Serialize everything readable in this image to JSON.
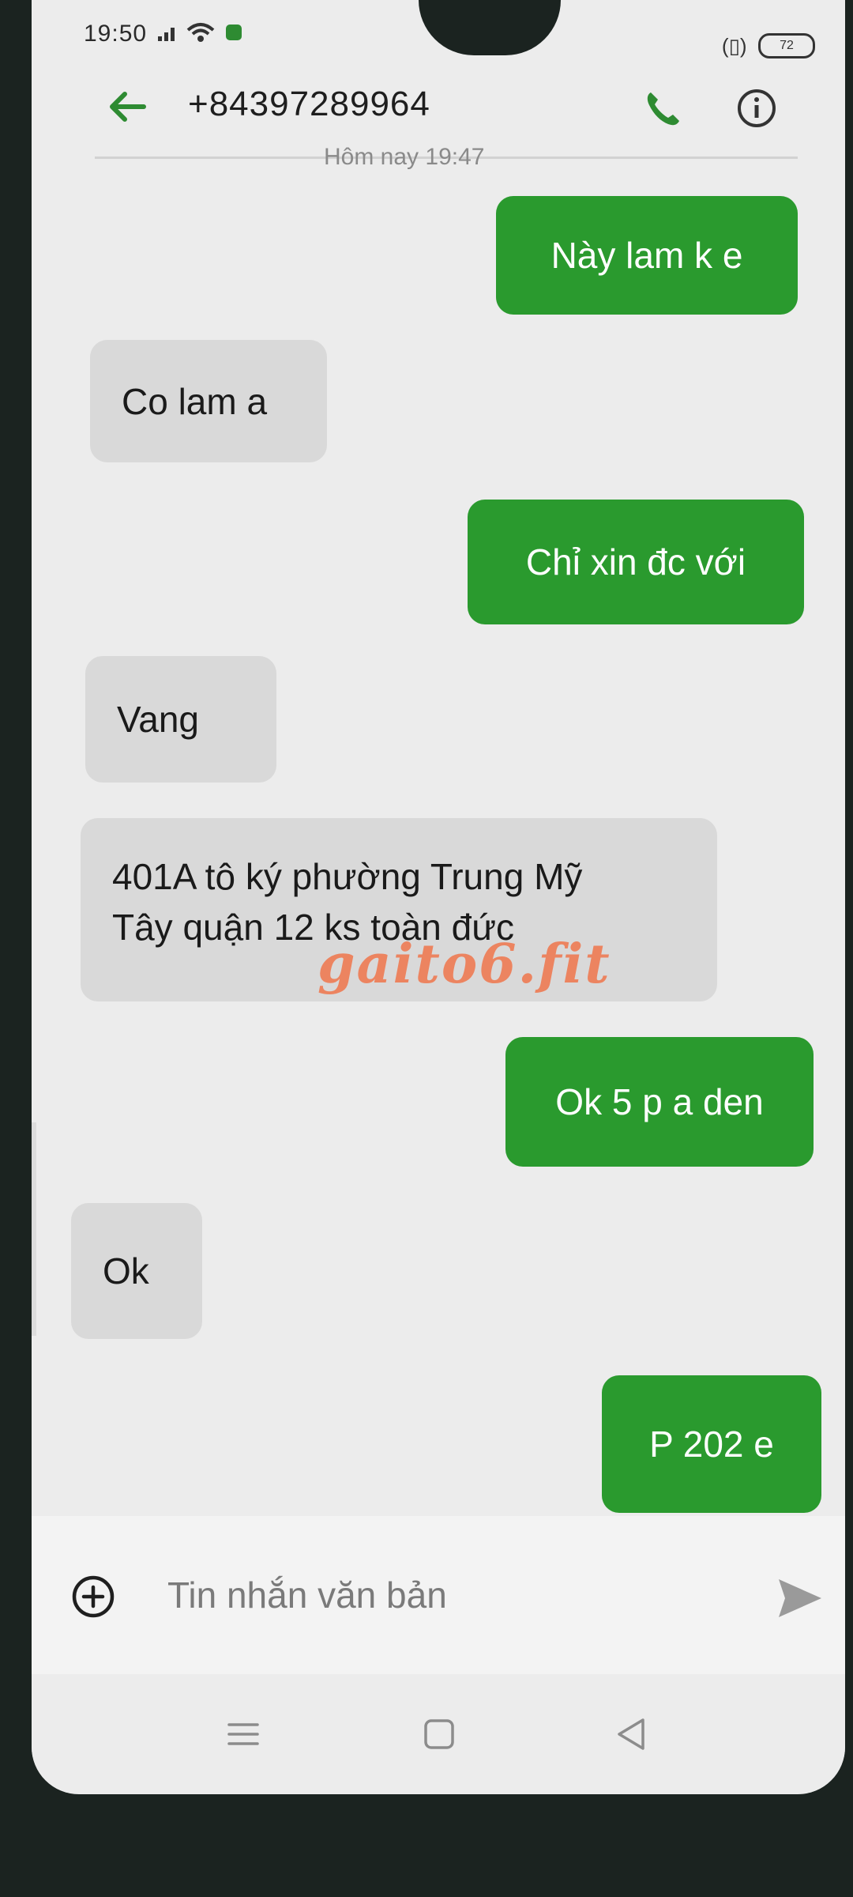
{
  "status_bar": {
    "time": "19:50",
    "battery": "72"
  },
  "header": {
    "contact": "+84397289964",
    "date_label": "Hôm nay 19:47"
  },
  "messages": [
    {
      "direction": "outgoing",
      "text": "Này  lam k e"
    },
    {
      "direction": "incoming",
      "text": "Co lam a"
    },
    {
      "direction": "outgoing",
      "text": "Chỉ xin đc với"
    },
    {
      "direction": "incoming",
      "text": "Vang"
    },
    {
      "direction": "incoming",
      "line1": "401A  tô ký phường Trung Mỹ",
      "line2": "Tây quận 12 ks toàn đức"
    },
    {
      "direction": "outgoing",
      "text": "Ok 5 p a den"
    },
    {
      "direction": "incoming",
      "text": "Ok"
    },
    {
      "direction": "outgoing",
      "text": "P 202 e"
    }
  ],
  "watermark": "gaito6.fit",
  "composer": {
    "placeholder": "Tin nhắn văn bản"
  },
  "colors": {
    "outgoing_bubble": "#2a9a2e",
    "incoming_bubble": "#d9d9d9",
    "back_arrow": "#2e8b32",
    "watermark": "#ee7d56"
  },
  "icons": [
    "back-arrow-icon",
    "phone-icon",
    "info-icon",
    "add-icon",
    "send-icon",
    "menu-icon",
    "home-icon",
    "back-nav-icon"
  ]
}
